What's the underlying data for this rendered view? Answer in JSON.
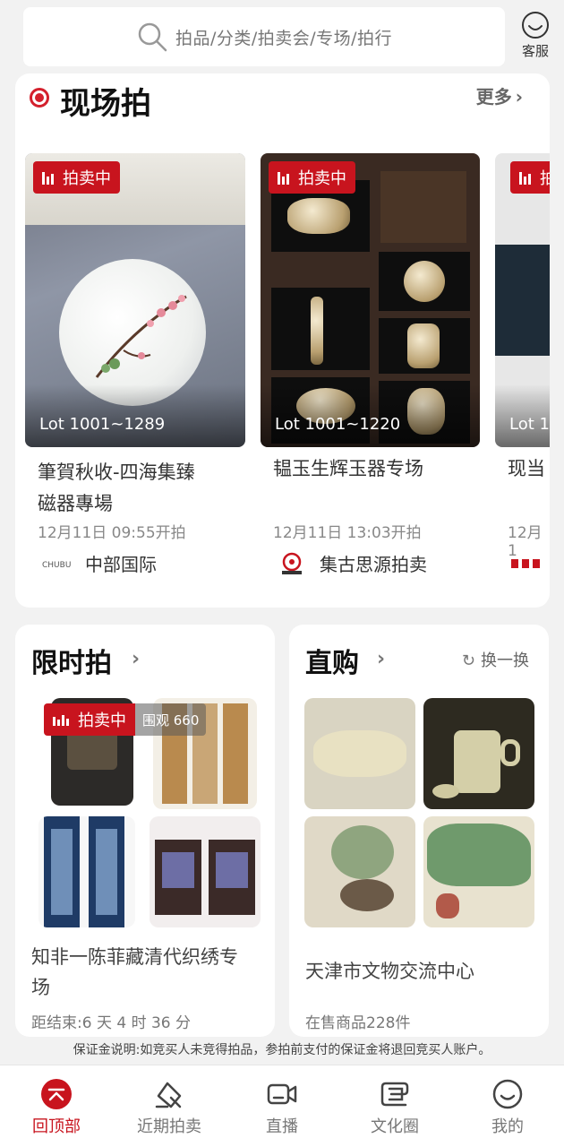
{
  "search": {
    "placeholder": "拍品/分类/拍卖会/专场/拍行"
  },
  "service": {
    "label": "客服"
  },
  "live": {
    "title": "现场拍",
    "more_label": "更多",
    "lots": [
      {
        "badge": "拍卖中",
        "lot_range": "Lot 1001~1289",
        "name_line1": "筆賀秋收-四海集臻",
        "name_line2": "磁器專場",
        "time": "12月11日 09:55开拍",
        "house": "中部国际"
      },
      {
        "badge": "拍卖中",
        "lot_range": "Lot 1001~1220",
        "name_line1": "韫玉生辉玉器专场",
        "name_line2": "",
        "time": "12月11日 13:03开拍",
        "house": "集古思源拍卖"
      },
      {
        "badge": "拍",
        "lot_range": "Lot 1",
        "name_line1": "现当",
        "name_line2": "",
        "time": "12月1",
        "house": ""
      }
    ]
  },
  "limited": {
    "title": "限时拍",
    "badge": "拍卖中",
    "viewers": "围观 660",
    "name_line1": "知非一陈菲藏清代织绣专",
    "name_line2": "场",
    "countdown": "距结束:6 天 4 时 36 分"
  },
  "direct": {
    "title": "直购",
    "swap_label": "换一换",
    "name": "天津市文物交流中心",
    "count": "在售商品228件"
  },
  "notice": "保证金说明:如竞买人未竞得拍品，参拍前支付的保证金将退回竞买人账户。",
  "nav": [
    {
      "label": "回顶部",
      "icon": "back-to-top-icon",
      "active": true
    },
    {
      "label": "近期拍卖",
      "icon": "auction-hammer-icon",
      "active": false
    },
    {
      "label": "直播",
      "icon": "video-camera-icon",
      "active": false
    },
    {
      "label": "文化圈",
      "icon": "culture-circle-icon",
      "active": false
    },
    {
      "label": "我的",
      "icon": "profile-icon",
      "active": false
    }
  ],
  "colors": {
    "accent": "#c8141e",
    "background": "#f2f2f2"
  }
}
